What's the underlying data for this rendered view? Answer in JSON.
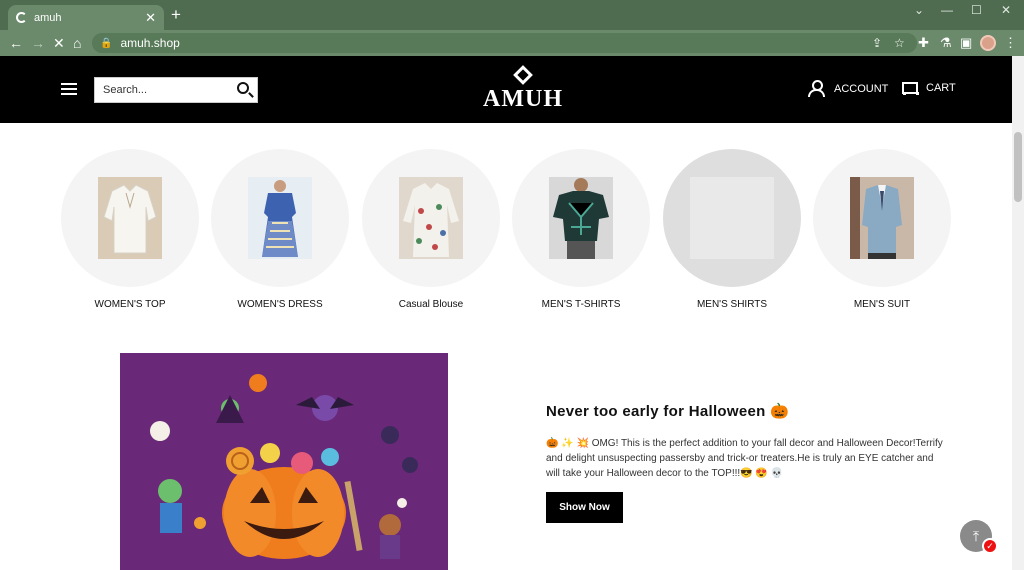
{
  "browser": {
    "tab_title": "amuh",
    "tab_close": "✕",
    "new_tab": "+",
    "url": "amuh.shop",
    "window_controls": [
      "⌄",
      "—",
      "☐",
      "✕"
    ],
    "nav": {
      "back": "←",
      "forward": "→",
      "stop": "✕",
      "home": "⌂"
    }
  },
  "header": {
    "search_placeholder": "Search...",
    "logo_text": "AMUH",
    "account_label": "ACCOUNT",
    "cart_label": "CART"
  },
  "categories": [
    {
      "label": "WOMEN'S TOP"
    },
    {
      "label": "WOMEN'S DRESS"
    },
    {
      "label": "Casual Blouse"
    },
    {
      "label": "MEN'S T-SHIRTS"
    },
    {
      "label": "MEN'S SHIRTS"
    },
    {
      "label": "MEN'S SUIT"
    }
  ],
  "promo": {
    "title": "Never too early for Halloween 🎃",
    "body": "🎃 ✨ 💥 OMG! This is the perfect addition to your fall decor and Halloween Decor!Terrify and delight unsuspecting passersby and trick-or treaters.He is truly an EYE catcher and will take your Halloween decor to the TOP!!!😎 😍 💀",
    "button_label": "Show Now"
  },
  "widgets": {
    "badge": "✓",
    "to_top": "⤒"
  }
}
